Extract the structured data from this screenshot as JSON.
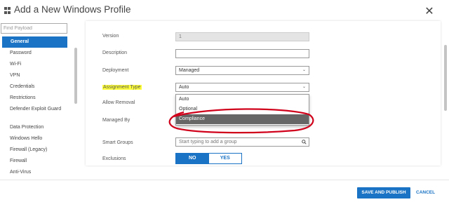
{
  "window": {
    "title": "Add a New Windows Profile",
    "close_icon": "close-icon"
  },
  "sidebar": {
    "search_placeholder": "Find Payload",
    "items": [
      {
        "label": "General",
        "active": true
      },
      {
        "label": "Password"
      },
      {
        "label": "Wi-Fi"
      },
      {
        "label": "VPN"
      },
      {
        "label": "Credentials"
      },
      {
        "label": "Restrictions"
      },
      {
        "label": "Defender Exploit Guard"
      },
      {
        "label": "Data Protection"
      },
      {
        "label": "Windows Hello"
      },
      {
        "label": "Firewall (Legacy)"
      },
      {
        "label": "Firewall"
      },
      {
        "label": "Anti-Virus"
      }
    ]
  },
  "form": {
    "version": {
      "label": "Version",
      "value": "1"
    },
    "description": {
      "label": "Description",
      "value": ""
    },
    "deployment": {
      "label": "Deployment",
      "value": "Managed"
    },
    "assignment_type": {
      "label": "Assignment Type",
      "value": "Auto",
      "options": [
        "Auto",
        "Optional",
        "Compliance"
      ],
      "highlighted_option": "Compliance"
    },
    "allow_removal": {
      "label": "Allow Removal"
    },
    "managed_by": {
      "label": "Managed By"
    },
    "smart_groups": {
      "label": "Smart Groups",
      "placeholder": "Start typing to add a group"
    },
    "exclusions": {
      "label": "Exclusions",
      "no_label": "NO",
      "yes_label": "YES",
      "selected": "NO"
    }
  },
  "footer": {
    "save_label": "SAVE AND PUBLISH",
    "cancel_label": "CANCEL"
  },
  "colors": {
    "accent": "#1a73c4",
    "highlight": "#ffff3a",
    "annotation": "#d0021b",
    "selected_option": "#666666"
  }
}
